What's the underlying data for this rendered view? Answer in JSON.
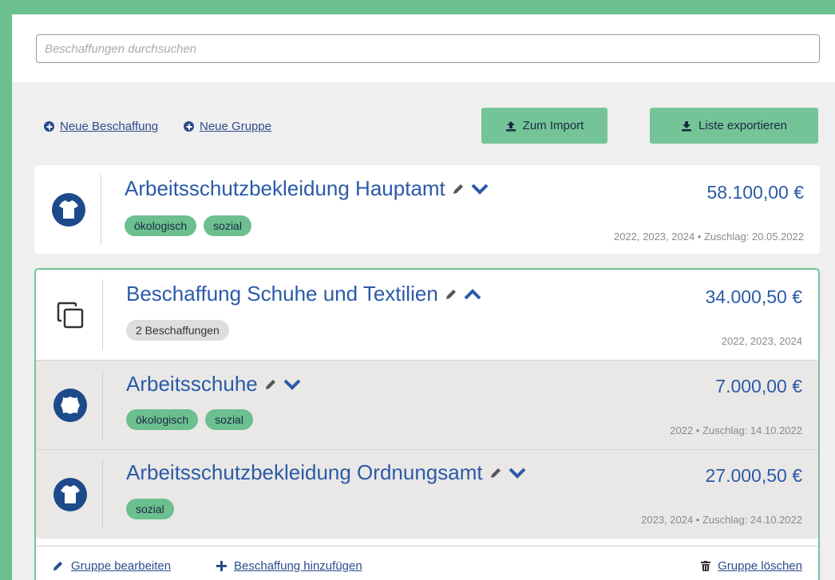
{
  "search": {
    "placeholder": "Beschaffungen durchsuchen"
  },
  "toolbar": {
    "new_procurement": "Neue Beschaffung",
    "new_group": "Neue Gruppe",
    "import_label": "Zum Import",
    "export_label": "Liste exportieren"
  },
  "items": [
    {
      "title": "Arbeitsschutzbekleidung Hauptamt",
      "price": "58.100,00 €",
      "tags": [
        "ökologisch",
        "sozial"
      ],
      "meta": "2022, 2023, 2024 • Zuschlag: 20.05.2022",
      "icon": "tshirt-icon"
    }
  ],
  "group": {
    "title": "Beschaffung Schuhe und Textilien",
    "price": "34.000,50 €",
    "count_badge": "2 Beschaffungen",
    "meta": "2022, 2023, 2024",
    "icon": "copy-icon",
    "children": [
      {
        "title": "Arbeitsschuhe",
        "price": "7.000,00 €",
        "tags": [
          "ökologisch",
          "sozial"
        ],
        "meta": "2022 • Zuschlag: 14.10.2022",
        "icon": "leather-icon"
      },
      {
        "title": "Arbeitsschutzbekleidung Ordnungsamt",
        "price": "27.000,50 €",
        "tags": [
          "sozial"
        ],
        "meta": "2023, 2024 • Zuschlag: 24.10.2022",
        "icon": "tshirt-icon"
      }
    ],
    "footer": {
      "edit_label": "Gruppe bearbeiten",
      "add_label": "Beschaffung hinzufügen",
      "delete_label": "Gruppe löschen"
    }
  },
  "colors": {
    "accent_green": "#74c497",
    "title_blue": "#2b5aa8",
    "dark_blue": "#2b4c8c"
  }
}
